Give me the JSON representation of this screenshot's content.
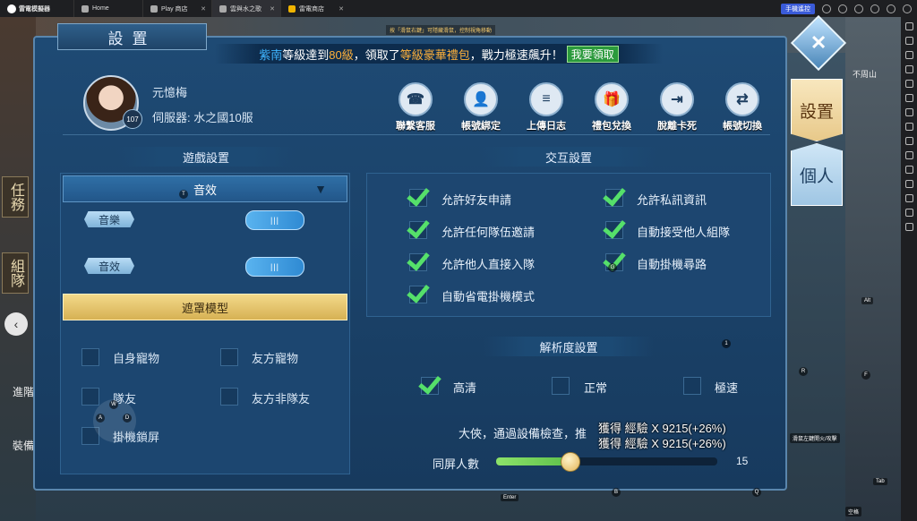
{
  "emulator": {
    "brand": "雷電模擬器",
    "tabs": [
      {
        "label": "Home"
      },
      {
        "label": "Play 商店"
      },
      {
        "label": "雲與水之歌"
      },
      {
        "label": "雷電商店"
      }
    ],
    "remote_label": "手機遙控"
  },
  "game_bg": {
    "side_task": "任務",
    "side_team": "組隊",
    "map_name": "不周山",
    "lower_side": "進階",
    "lower_side2": "裝備"
  },
  "panel": {
    "title": "設置",
    "hint": "按「滑鼠右鍵」可隱藏滑鼠，控制視角移動",
    "banner": {
      "name": "紫南",
      "text1": "等級達到",
      "level": "80級",
      "text2": "，領取了",
      "pack": "等級豪華禮包",
      "text3": "，戰力極速飆升！",
      "button": "我要領取"
    },
    "profile": {
      "name": "元憶梅",
      "server": "伺服器: 水之國10服",
      "level": "107"
    },
    "actions": [
      {
        "label": "聯繫客服",
        "icon": "headset-icon",
        "glyph": "☎"
      },
      {
        "label": "帳號綁定",
        "icon": "user-icon",
        "glyph": "👤"
      },
      {
        "label": "上傳日志",
        "icon": "document-icon",
        "glyph": "≡"
      },
      {
        "label": "禮包兌換",
        "icon": "gift-icon",
        "glyph": "🎁"
      },
      {
        "label": "脫離卡死",
        "icon": "exit-icon",
        "glyph": "⇥"
      },
      {
        "label": "帳號切換",
        "icon": "switch-icon",
        "glyph": "⇄"
      }
    ],
    "game_settings": {
      "title": "遊戲設置",
      "sound_header": "音效",
      "music_label": "音樂",
      "sfx_label": "音效",
      "toggle_glyph": "|||",
      "mask_header": "遮罩模型",
      "mask_items": [
        "自身寵物",
        "友方寵物",
        "隊友",
        "友方非隊友",
        "掛機鎖屏"
      ]
    },
    "interaction": {
      "title": "交互設置",
      "items": [
        {
          "label": "允許好友申請",
          "checked": true
        },
        {
          "label": "允許私訊資訊",
          "checked": true
        },
        {
          "label": "允許任何隊伍邀請",
          "checked": true
        },
        {
          "label": "自動接受他人組隊",
          "checked": true
        },
        {
          "label": "允許他人直接入隊",
          "checked": true
        },
        {
          "label": "自動掛機尋路",
          "checked": true
        },
        {
          "label": "自動省電掛機模式",
          "checked": true
        }
      ]
    },
    "resolution": {
      "title": "解析度設置",
      "options": [
        {
          "label": "高清",
          "selected": true
        },
        {
          "label": "正常",
          "selected": false
        },
        {
          "label": "極速",
          "selected": false
        }
      ],
      "notice": "大俠，通過設備檢查，推",
      "reward1": "獲得 經驗 X 9215(+26%)",
      "reward2": "獲得 經驗 X 9215(+26%)",
      "slider_label": "同屏人數",
      "slider_value": "15",
      "slider_fraction": 0.33
    },
    "right_tabs": {
      "settings": "設置",
      "personal": "個人"
    }
  },
  "keys": {
    "t": "T",
    "w": "W",
    "a": "A",
    "d": "D",
    "g": "G",
    "one": "1",
    "r": "R",
    "f": "F",
    "b": "B",
    "q": "Q",
    "enter": "Enter",
    "space": "空格",
    "tab": "Tab",
    "alt": "Alt",
    "hint_right": "滑鼠左鍵開火/攻擊"
  }
}
